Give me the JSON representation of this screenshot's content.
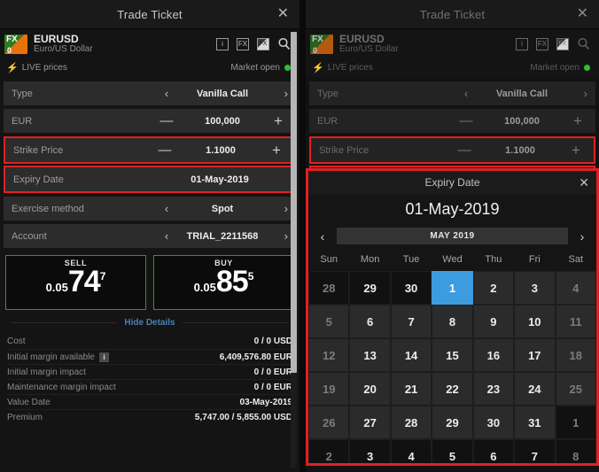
{
  "window": {
    "title": "Trade Ticket",
    "close_label": "✕"
  },
  "instrument": {
    "logo_top": "FX",
    "logo_bottom": "0",
    "symbol": "EURUSD",
    "description": "Euro/US Dollar",
    "icons": [
      "info-icon",
      "fx-icon",
      "chart-icon",
      "search-icon"
    ],
    "info_icon_label": "i",
    "fx_icon_label": "FX",
    "chart_icon_label": "FX"
  },
  "status": {
    "live_label": "LIVE prices",
    "bolt": "⚡",
    "market_label": "Market open",
    "market_color": "#2fc02f"
  },
  "form": {
    "rows": [
      {
        "label": "Type",
        "value": "Vanilla Call",
        "control": "arrows",
        "highlight": false
      },
      {
        "label": "EUR",
        "value": "100,000",
        "control": "stepper",
        "highlight": false
      },
      {
        "label": "Strike Price",
        "value": "1.1000",
        "control": "stepper",
        "highlight": true
      },
      {
        "label": "Expiry Date",
        "value": "01-May-2019",
        "control": "none",
        "highlight": true
      },
      {
        "label": "Exercise method",
        "value": "Spot",
        "control": "arrows",
        "highlight": false
      },
      {
        "label": "Account",
        "value": "TRIAL_2211568",
        "control": "arrows",
        "highlight": false
      }
    ],
    "left_arrow": "‹",
    "right_arrow": "›",
    "minus": "—",
    "plus": "+"
  },
  "quotes": [
    {
      "side": "SELL",
      "prefix": "0.05",
      "big": "74",
      "sup": "7"
    },
    {
      "side": "BUY",
      "prefix": "0.05",
      "big": "85",
      "sup": "5"
    }
  ],
  "details_toggle": "Hide Details",
  "details": [
    {
      "label": "Initial margin available",
      "value": "6,409,576.80 EUR",
      "info": "i"
    },
    {
      "label": "Cost",
      "value": "0 / 0 USD"
    },
    {
      "label": "Initial margin impact",
      "value": "0 / 0 EUR"
    },
    {
      "label": "Maintenance margin impact",
      "value": "0 / 0 EUR"
    },
    {
      "label": "Value Date",
      "value": "03-May-2019"
    },
    {
      "label": "Premium",
      "value": "5,747.00 / 5,855.00 USD"
    }
  ],
  "details_ordered": [
    {
      "label": "Cost",
      "value": "0 / 0 USD",
      "info": false
    },
    {
      "label": "Initial margin available",
      "value": "6,409,576.80 EUR",
      "info": true
    },
    {
      "label": "Initial margin impact",
      "value": "0 / 0 EUR",
      "info": false
    },
    {
      "label": "Maintenance margin impact",
      "value": "0 / 0 EUR",
      "info": false
    },
    {
      "label": "Value Date",
      "value": "03-May-2019",
      "info": false
    },
    {
      "label": "Premium",
      "value": "5,747.00 / 5,855.00 USD",
      "info": false
    }
  ],
  "calendar": {
    "title": "Expiry Date",
    "close_label": "✕",
    "selected_date": "01-May-2019",
    "month_label": "MAY 2019",
    "prev_label": "‹",
    "next_label": "›",
    "weekdays": [
      "Sun",
      "Mon",
      "Tue",
      "Wed",
      "Thu",
      "Fri",
      "Sat"
    ],
    "selected_day": 1,
    "accent_color": "#3d9be0",
    "highlight_color": "#e02020",
    "weeks": [
      [
        {
          "d": "28",
          "out": true,
          "muted": true
        },
        {
          "d": "29",
          "out": true
        },
        {
          "d": "30",
          "out": true
        },
        {
          "d": "1",
          "sel": true
        },
        {
          "d": "2"
        },
        {
          "d": "3"
        },
        {
          "d": "4",
          "muted": true
        }
      ],
      [
        {
          "d": "5",
          "muted": true
        },
        {
          "d": "6"
        },
        {
          "d": "7"
        },
        {
          "d": "8"
        },
        {
          "d": "9"
        },
        {
          "d": "10"
        },
        {
          "d": "11",
          "muted": true
        }
      ],
      [
        {
          "d": "12",
          "muted": true
        },
        {
          "d": "13"
        },
        {
          "d": "14"
        },
        {
          "d": "15"
        },
        {
          "d": "16"
        },
        {
          "d": "17"
        },
        {
          "d": "18",
          "muted": true
        }
      ],
      [
        {
          "d": "19",
          "muted": true
        },
        {
          "d": "20"
        },
        {
          "d": "21"
        },
        {
          "d": "22"
        },
        {
          "d": "23"
        },
        {
          "d": "24"
        },
        {
          "d": "25",
          "muted": true
        }
      ],
      [
        {
          "d": "26",
          "muted": true
        },
        {
          "d": "27"
        },
        {
          "d": "28"
        },
        {
          "d": "29"
        },
        {
          "d": "30"
        },
        {
          "d": "31"
        },
        {
          "d": "1",
          "out": true,
          "muted": true
        }
      ],
      [
        {
          "d": "2",
          "out": true,
          "muted": true
        },
        {
          "d": "3",
          "out": true
        },
        {
          "d": "4",
          "out": true
        },
        {
          "d": "5",
          "out": true
        },
        {
          "d": "6",
          "out": true
        },
        {
          "d": "7",
          "out": true
        },
        {
          "d": "8",
          "out": true,
          "muted": true
        }
      ]
    ]
  }
}
